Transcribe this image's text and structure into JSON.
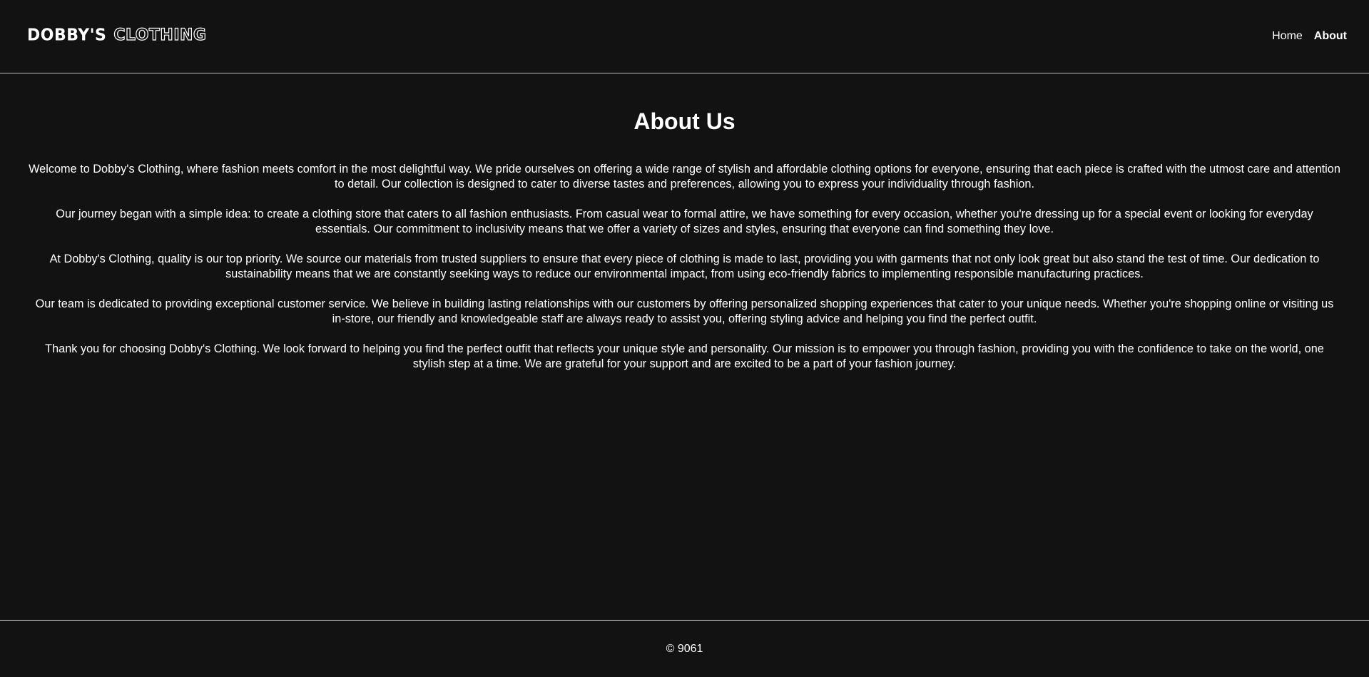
{
  "header": {
    "logo_part1": "DOBBY'S",
    "logo_part2": "CLOTHING",
    "nav": {
      "home": "Home",
      "about": "About"
    }
  },
  "main": {
    "title": "About Us",
    "paragraphs": [
      "Welcome to Dobby's Clothing, where fashion meets comfort in the most delightful way. We pride ourselves on offering a wide range of stylish and affordable clothing options for everyone, ensuring that each piece is crafted with the utmost care and attention to detail. Our collection is designed to cater to diverse tastes and preferences, allowing you to express your individuality through fashion.",
      "Our journey began with a simple idea: to create a clothing store that caters to all fashion enthusiasts. From casual wear to formal attire, we have something for every occasion, whether you're dressing up for a special event or looking for everyday essentials. Our commitment to inclusivity means that we offer a variety of sizes and styles, ensuring that everyone can find something they love.",
      "At Dobby's Clothing, quality is our top priority. We source our materials from trusted suppliers to ensure that every piece of clothing is made to last, providing you with garments that not only look great but also stand the test of time. Our dedication to sustainability means that we are constantly seeking ways to reduce our environmental impact, from using eco-friendly fabrics to implementing responsible manufacturing practices.",
      "Our team is dedicated to providing exceptional customer service. We believe in building lasting relationships with our customers by offering personalized shopping experiences that cater to your unique needs. Whether you're shopping online or visiting us in-store, our friendly and knowledgeable staff are always ready to assist you, offering styling advice and helping you find the perfect outfit.",
      "Thank you for choosing Dobby's Clothing. We look forward to helping you find the perfect outfit that reflects your unique style and personality. Our mission is to empower you through fashion, providing you with the confidence to take on the world, one stylish step at a time. We are grateful for your support and are excited to be a part of your fashion journey."
    ]
  },
  "footer": {
    "copyright": "© 9061"
  },
  "colors": {
    "background": "#121212",
    "text": "#ffffff",
    "divider": "#bdbdbd"
  }
}
